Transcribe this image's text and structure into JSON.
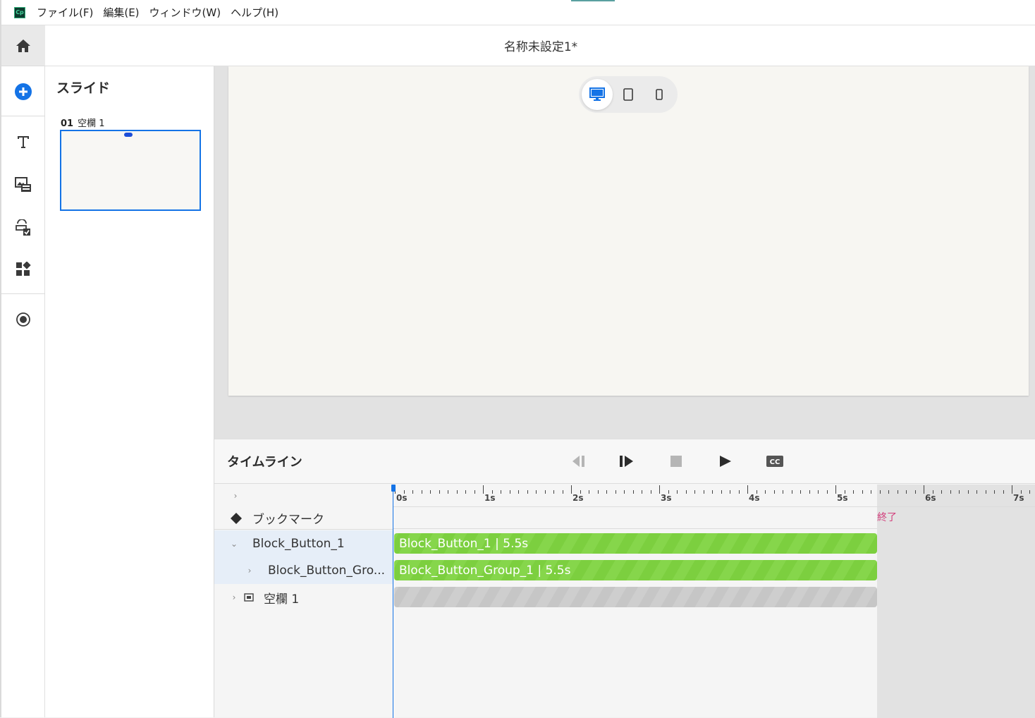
{
  "menubar": {
    "logo": "Cp",
    "items": [
      "ファイル(F)",
      "編集(E)",
      "ウィンドウ(W)",
      "ヘルプ(H)"
    ]
  },
  "title": "名称未設定1*",
  "rail": {
    "icons": [
      "home-icon",
      "add-circle-icon",
      "text-icon",
      "media-icon",
      "interaction-icon",
      "widgets-icon",
      "record-icon"
    ]
  },
  "slides": {
    "title": "スライド",
    "items": [
      {
        "number": "01",
        "name": "空欄 1"
      }
    ]
  },
  "stage": {
    "devices": [
      "desktop-icon",
      "tablet-icon",
      "mobile-icon"
    ],
    "selected_device": "desktop"
  },
  "timeline": {
    "title": "タイムライン",
    "controls": [
      "rewind-icon",
      "step-forward-icon",
      "stop-icon",
      "play-icon",
      "cc-icon"
    ],
    "ruler_labels": [
      "0s",
      "1s",
      "2s",
      "3s",
      "4s",
      "5s",
      "6s",
      "7s"
    ],
    "end_label": "終了",
    "rows": [
      {
        "label": "ブックマーク"
      },
      {
        "label": "Block_Button_1",
        "bar": "Block_Button_1 | 5.5s"
      },
      {
        "label": "Block_Button_Gro...",
        "bar": "Block_Button_Group_1 | 5.5s"
      },
      {
        "label": "空欄 1",
        "bar": ""
      }
    ]
  },
  "colors": {
    "accent": "#1473e6",
    "bar_green": "#7ccf3f",
    "end_marker": "#d23c7a"
  }
}
